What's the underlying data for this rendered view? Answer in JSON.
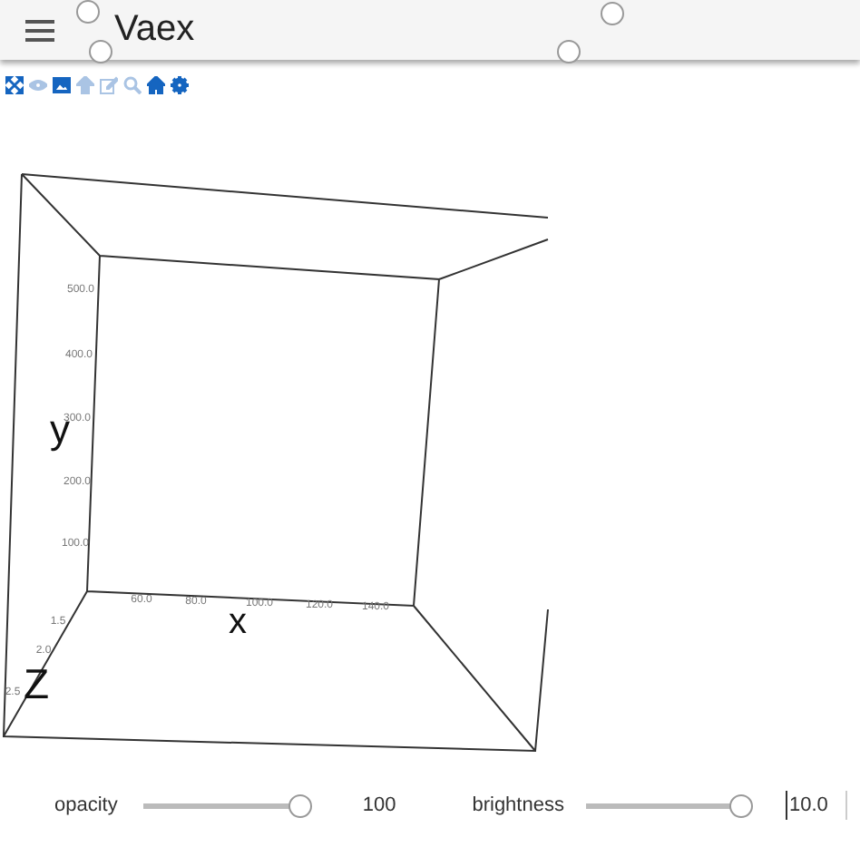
{
  "app_bar": {
    "title": "Vaex"
  },
  "toolbar": [
    {
      "disabled": false
    },
    {
      "disabled": true
    },
    {
      "disabled": false
    },
    {
      "disabled": true
    },
    {
      "disabled": true
    },
    {
      "disabled": true
    },
    {
      "disabled": false
    },
    {
      "disabled": false
    }
  ],
  "plot": {
    "y_label": "y",
    "x_label": "x",
    "z_label": "Z",
    "y_ticks": [
      "500.0",
      "400.0",
      "300.0",
      "200.0",
      "100.0"
    ],
    "x_ticks": [
      "60.0",
      "80.0",
      "100.0",
      "120.0",
      "140.0"
    ],
    "z_ticks": [
      "1.5",
      "2.0",
      "2.5"
    ]
  },
  "controls": [
    {
      "label": "opacity",
      "level": 1.0,
      "value": "100"
    },
    {
      "label": "brightness",
      "level": 1.0,
      "value": "10.0"
    }
  ]
}
